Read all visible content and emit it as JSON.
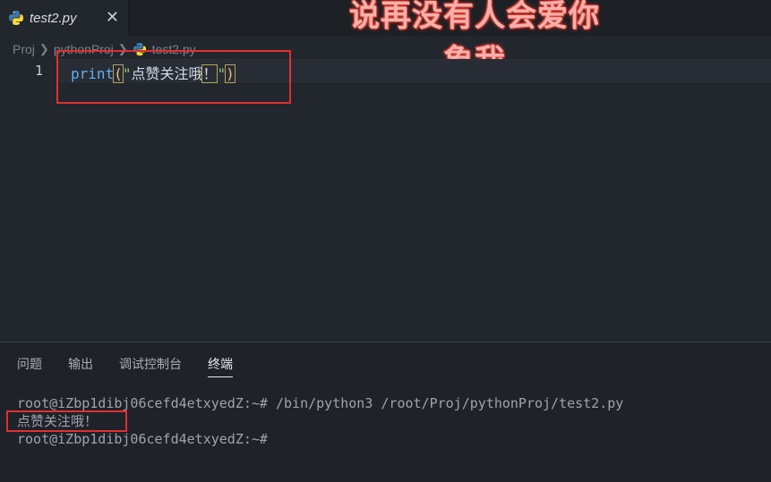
{
  "tab": {
    "label": "test2.py",
    "close_glyph": "✕"
  },
  "overlay": {
    "line1": "说再没有人会爱你",
    "line2": "象我"
  },
  "breadcrumb": {
    "items": [
      "Proj",
      "pythonProj",
      "test2.py"
    ]
  },
  "editor": {
    "line_number": "1",
    "code": {
      "fn": "print",
      "open_paren": "(",
      "quote_open": "\"",
      "text": "点赞关注哦",
      "bang": "！",
      "quote_close": "\"",
      "close_paren": ")"
    }
  },
  "panel": {
    "tabs": [
      "问题",
      "输出",
      "调试控制台",
      "终端"
    ],
    "active_tab": "终端"
  },
  "terminal": {
    "line1": "root@iZbp1dibj06cefd4etxyedZ:~# /bin/python3 /root/Proj/pythonProj/test2.py",
    "line2": "点赞关注哦！",
    "line3": "root@iZbp1dibj06cefd4etxyedZ:~#"
  },
  "colors": {
    "highlight_box": "#e0302f",
    "overlay_text": "#f4b2ad",
    "function": "#61afef",
    "bracket": "#e5c07b"
  },
  "icons": {
    "file_icon": "python-icon",
    "separator": "chevron-right-icon"
  }
}
